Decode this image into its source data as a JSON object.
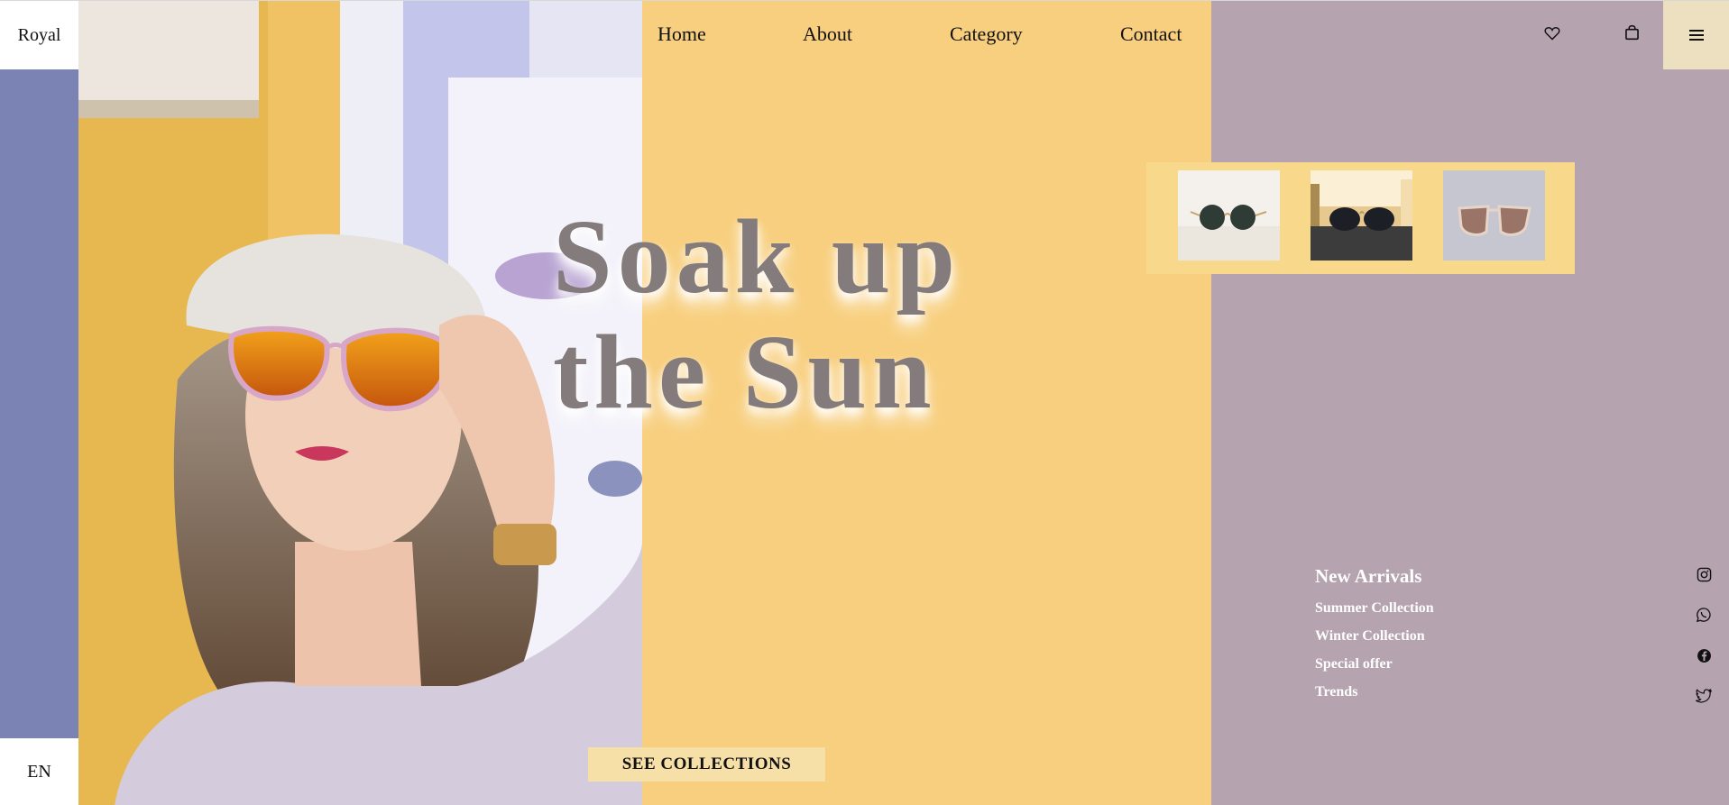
{
  "brand": {
    "logo": "Royal",
    "language": "EN"
  },
  "nav": {
    "items": [
      {
        "label": "Home"
      },
      {
        "label": "About"
      },
      {
        "label": "Category"
      },
      {
        "label": "Contact"
      }
    ]
  },
  "header_icons": {
    "wishlist": "heart-icon",
    "cart": "shopping-bag-icon",
    "menu": "hamburger-menu-icon"
  },
  "hero": {
    "headline_line1": "Soak up",
    "headline_line2": "the Sun",
    "cta_label": "SEE COLLECTIONS"
  },
  "thumbnails": [
    {
      "name": "round-green-lens-sunglasses"
    },
    {
      "name": "dark-aviator-sunglasses"
    },
    {
      "name": "cat-eye-gradient-sunglasses"
    }
  ],
  "arrivals": {
    "title": "New Arrivals",
    "links": [
      "Summer Collection",
      "Winter Collection",
      "Special offer",
      "Trends"
    ]
  },
  "social": [
    "instagram-icon",
    "whatsapp-icon",
    "facebook-icon",
    "twitter-icon"
  ],
  "colors": {
    "rail": "#7b83b5",
    "yellow_panel": "#f8cf7e",
    "mauve_panel": "#b6a3b0",
    "headline": "#847c7c",
    "button": "#f7e0a8"
  }
}
